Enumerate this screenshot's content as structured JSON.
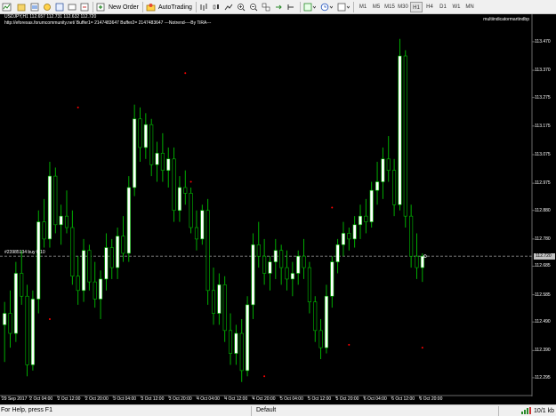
{
  "toolbar": {
    "new_order_label": "New Order",
    "autotrading_label": "AutoTrading",
    "timeframes": [
      "M1",
      "M5",
      "M15",
      "M30",
      "H1",
      "H4",
      "D1",
      "W1",
      "MN"
    ],
    "active_timeframe": "H1"
  },
  "chart": {
    "header": "USDJPY,H1  112.657 112.731 112.632 112.720",
    "indicator_line": "http://eforexas.forumcommunity.net/  Buffer1= 2147483647   Buffer2= 2147483647   ---Notrend----By TiRA---",
    "top_right_label": "multiindicatormartindbp",
    "order_label": "#23985134  buy 0.10",
    "current_price": "112.720",
    "price_ticks": [
      "113.470",
      "113.370",
      "113.275",
      "113.175",
      "113.075",
      "112.975",
      "112.880",
      "112.780",
      "112.685",
      "112.585",
      "112.490",
      "112.390",
      "112.295"
    ],
    "time_ticks": [
      "29 Sep 2017",
      "2 Oct 04:00",
      "2 Oct 12:00",
      "2 Oct 20:00",
      "3 Oct 04:00",
      "3 Oct 12:00",
      "3 Oct 20:00",
      "4 Oct 04:00",
      "4 Oct 12:00",
      "4 Oct 20:00",
      "5 Oct 04:00",
      "5 Oct 12:00",
      "5 Oct 20:00",
      "6 Oct 04:00",
      "6 Oct 12:00",
      "6 Oct 20:00"
    ],
    "colors": {
      "bull": "#ffffff",
      "bear": "#000000",
      "wick": "#00c000",
      "dot": "#ff0000",
      "order_line": "#8a8a8a"
    }
  },
  "chart_data": {
    "type": "candlestick",
    "symbol": "USDJPY",
    "timeframe": "H1",
    "last_bar": {
      "open": 112.657,
      "high": 112.731,
      "low": 112.632,
      "close": 112.72
    },
    "ylim": [
      112.245,
      113.535
    ],
    "order_price": 112.72,
    "candles": [
      [
        112.48,
        112.56,
        112.35,
        112.52
      ],
      [
        112.52,
        112.6,
        112.4,
        112.45
      ],
      [
        112.45,
        112.7,
        112.42,
        112.66
      ],
      [
        112.66,
        112.74,
        112.55,
        112.58
      ],
      [
        112.58,
        112.62,
        112.3,
        112.34
      ],
      [
        112.34,
        112.6,
        112.32,
        112.57
      ],
      [
        112.57,
        112.88,
        112.52,
        112.84
      ],
      [
        112.84,
        112.92,
        112.75,
        112.78
      ],
      [
        112.78,
        113.05,
        112.75,
        113.0
      ],
      [
        113.0,
        113.03,
        112.8,
        112.83
      ],
      [
        112.83,
        112.9,
        112.76,
        112.86
      ],
      [
        112.86,
        112.95,
        112.8,
        112.82
      ],
      [
        112.82,
        112.88,
        112.62,
        112.65
      ],
      [
        112.65,
        112.72,
        112.55,
        112.6
      ],
      [
        112.6,
        112.78,
        112.56,
        112.74
      ],
      [
        112.74,
        112.76,
        112.6,
        112.63
      ],
      [
        112.63,
        112.7,
        112.54,
        112.57
      ],
      [
        112.57,
        112.67,
        112.5,
        112.64
      ],
      [
        112.64,
        112.8,
        112.6,
        112.75
      ],
      [
        112.75,
        112.78,
        112.64,
        112.68
      ],
      [
        112.68,
        112.82,
        112.64,
        112.79
      ],
      [
        112.79,
        112.86,
        112.7,
        112.73
      ],
      [
        112.73,
        113.0,
        112.7,
        112.96
      ],
      [
        112.96,
        113.25,
        112.93,
        113.2
      ],
      [
        113.2,
        113.24,
        113.05,
        113.1
      ],
      [
        113.1,
        113.22,
        113.06,
        113.18
      ],
      [
        113.18,
        113.2,
        113.0,
        113.04
      ],
      [
        113.04,
        113.12,
        112.98,
        113.08
      ],
      [
        113.08,
        113.15,
        112.98,
        113.02
      ],
      [
        113.02,
        113.1,
        112.96,
        113.06
      ],
      [
        113.06,
        113.1,
        112.84,
        112.88
      ],
      [
        112.88,
        113.0,
        112.84,
        112.96
      ],
      [
        112.96,
        113.02,
        112.9,
        112.94
      ],
      [
        112.94,
        112.96,
        112.8,
        112.82
      ],
      [
        112.82,
        112.88,
        112.74,
        112.78
      ],
      [
        112.78,
        112.9,
        112.76,
        112.88
      ],
      [
        112.88,
        112.92,
        112.55,
        112.6
      ],
      [
        112.6,
        112.68,
        112.48,
        112.52
      ],
      [
        112.52,
        112.66,
        112.48,
        112.62
      ],
      [
        112.62,
        112.65,
        112.42,
        112.46
      ],
      [
        112.46,
        112.52,
        112.34,
        112.38
      ],
      [
        112.38,
        112.48,
        112.34,
        112.45
      ],
      [
        112.45,
        112.5,
        112.28,
        112.32
      ],
      [
        112.32,
        112.58,
        112.3,
        112.55
      ],
      [
        112.55,
        112.8,
        112.5,
        112.76
      ],
      [
        112.76,
        112.84,
        112.68,
        112.72
      ],
      [
        112.72,
        112.78,
        112.62,
        112.66
      ],
      [
        112.66,
        112.72,
        112.6,
        112.7
      ],
      [
        112.7,
        112.78,
        112.64,
        112.74
      ],
      [
        112.74,
        112.76,
        112.62,
        112.68
      ],
      [
        112.68,
        112.74,
        112.6,
        112.64
      ],
      [
        112.64,
        112.7,
        112.58,
        112.66
      ],
      [
        112.66,
        112.74,
        112.62,
        112.72
      ],
      [
        112.72,
        112.78,
        112.64,
        112.68
      ],
      [
        112.68,
        112.7,
        112.52,
        112.56
      ],
      [
        112.56,
        112.58,
        112.42,
        112.46
      ],
      [
        112.46,
        112.5,
        112.36,
        112.4
      ],
      [
        112.4,
        112.62,
        112.38,
        112.58
      ],
      [
        112.58,
        112.72,
        112.54,
        112.7
      ],
      [
        112.7,
        112.78,
        112.66,
        112.76
      ],
      [
        112.76,
        112.84,
        112.72,
        112.8
      ],
      [
        112.8,
        112.82,
        112.74,
        112.78
      ],
      [
        112.78,
        112.86,
        112.75,
        112.83
      ],
      [
        112.83,
        112.9,
        112.78,
        112.86
      ],
      [
        112.86,
        112.92,
        112.8,
        112.84
      ],
      [
        112.84,
        112.98,
        112.82,
        112.95
      ],
      [
        112.95,
        113.05,
        112.9,
        112.98
      ],
      [
        112.98,
        113.1,
        112.92,
        113.06
      ],
      [
        113.06,
        113.14,
        112.98,
        113.02
      ],
      [
        113.02,
        113.06,
        112.86,
        112.9
      ],
      [
        112.9,
        113.48,
        112.88,
        113.42
      ],
      [
        113.42,
        113.44,
        112.82,
        112.86
      ],
      [
        112.86,
        112.9,
        112.68,
        112.72
      ],
      [
        112.72,
        112.8,
        112.64,
        112.68
      ],
      [
        112.68,
        112.73,
        112.63,
        112.72
      ]
    ],
    "red_dots": [
      [
        13,
        113.24
      ],
      [
        32,
        113.36
      ],
      [
        33,
        112.98
      ],
      [
        58,
        112.89
      ],
      [
        74,
        112.4
      ],
      [
        8,
        112.5
      ],
      [
        46,
        112.3
      ],
      [
        61,
        112.41
      ]
    ]
  }
}
